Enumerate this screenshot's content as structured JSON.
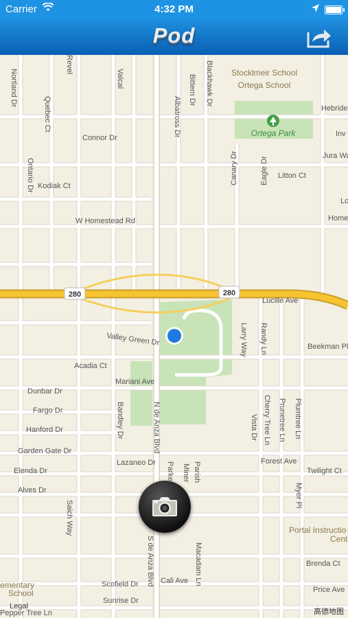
{
  "status_bar": {
    "carrier": "Carrier",
    "time": "4:32 PM"
  },
  "nav": {
    "title": "Pod",
    "share_icon": "share-arrow-icon"
  },
  "map": {
    "streets": {
      "valcal": "Valcal",
      "revel": "Revel",
      "nortland": "Nortland Dr",
      "quebec": "Quebec Ct",
      "connor": "Connor Dr",
      "ontario": "Ontario Dr",
      "kodiak": "Kodiak Ct",
      "albatross": "Albatross Dr",
      "bittern": "Bittern Dr",
      "blackhawk": "Blackhawk Dr",
      "canary": "Canary Dr",
      "eagle": "Eagle Dr",
      "litton": "Litton Ct",
      "jura": "Jura Wa",
      "lo": "Lo",
      "homestead": "W Homestead Rd",
      "homestead_right": "Home",
      "hebride": "Hebride",
      "inv": "Inv",
      "lucille": "Lucille Ave",
      "valley_green": "Valley Green Dr",
      "acadia": "Acadia Ct",
      "mariani": "Mariani Ave",
      "larry": "Larry Way",
      "randy": "Randy Ln",
      "beekman": "Beekman Pl",
      "dunbar": "Dunbar Dr",
      "fargo": "Fargo Dr",
      "hanford": "Hanford Dr",
      "garden_gate": "Garden Gate Dr",
      "elenda": "Elenda Dr",
      "alves": "Alves Dr",
      "bandley": "Bandley Dr",
      "n_de_anza": "N de Anza Blvd",
      "lazaneo": "Lazaneo Dr",
      "cherry_tree": "Cherry Tree Ln",
      "prunetree": "Prunetree Ln",
      "plumtree": "Plumtree Ln",
      "vista": "Vista Dr",
      "forest": "Forest Ave",
      "twilight": "Twilight Ct",
      "myer": "Myer Pl",
      "parker": "Parker",
      "miner": "Miner",
      "parish": "Parish",
      "saich": "Saich Way",
      "s_de_anza": "S de Anza Blvd",
      "macadam": "Macadam Ln",
      "cali": "Cali Ave",
      "brenda": "Brenda Ct",
      "price": "Price Ave",
      "scofield": "Scofield Dr",
      "sunrise": "Sunrise Dr",
      "pepper_tree": "Pepper Tree Ln"
    },
    "places": {
      "stocklmeir": "Stocklmeir School",
      "ortega_school": "Ortega School",
      "ortega_park": "Ortega Park",
      "portal_1": "Portal Instructio",
      "portal_2": "Cent",
      "elementary_1": "ementary",
      "elementary_2": "School"
    },
    "highway_shield_left": "280",
    "highway_shield_right": "280",
    "legal": "Legal",
    "credit": "高德地图"
  },
  "camera_button": {
    "icon": "camera-icon"
  }
}
